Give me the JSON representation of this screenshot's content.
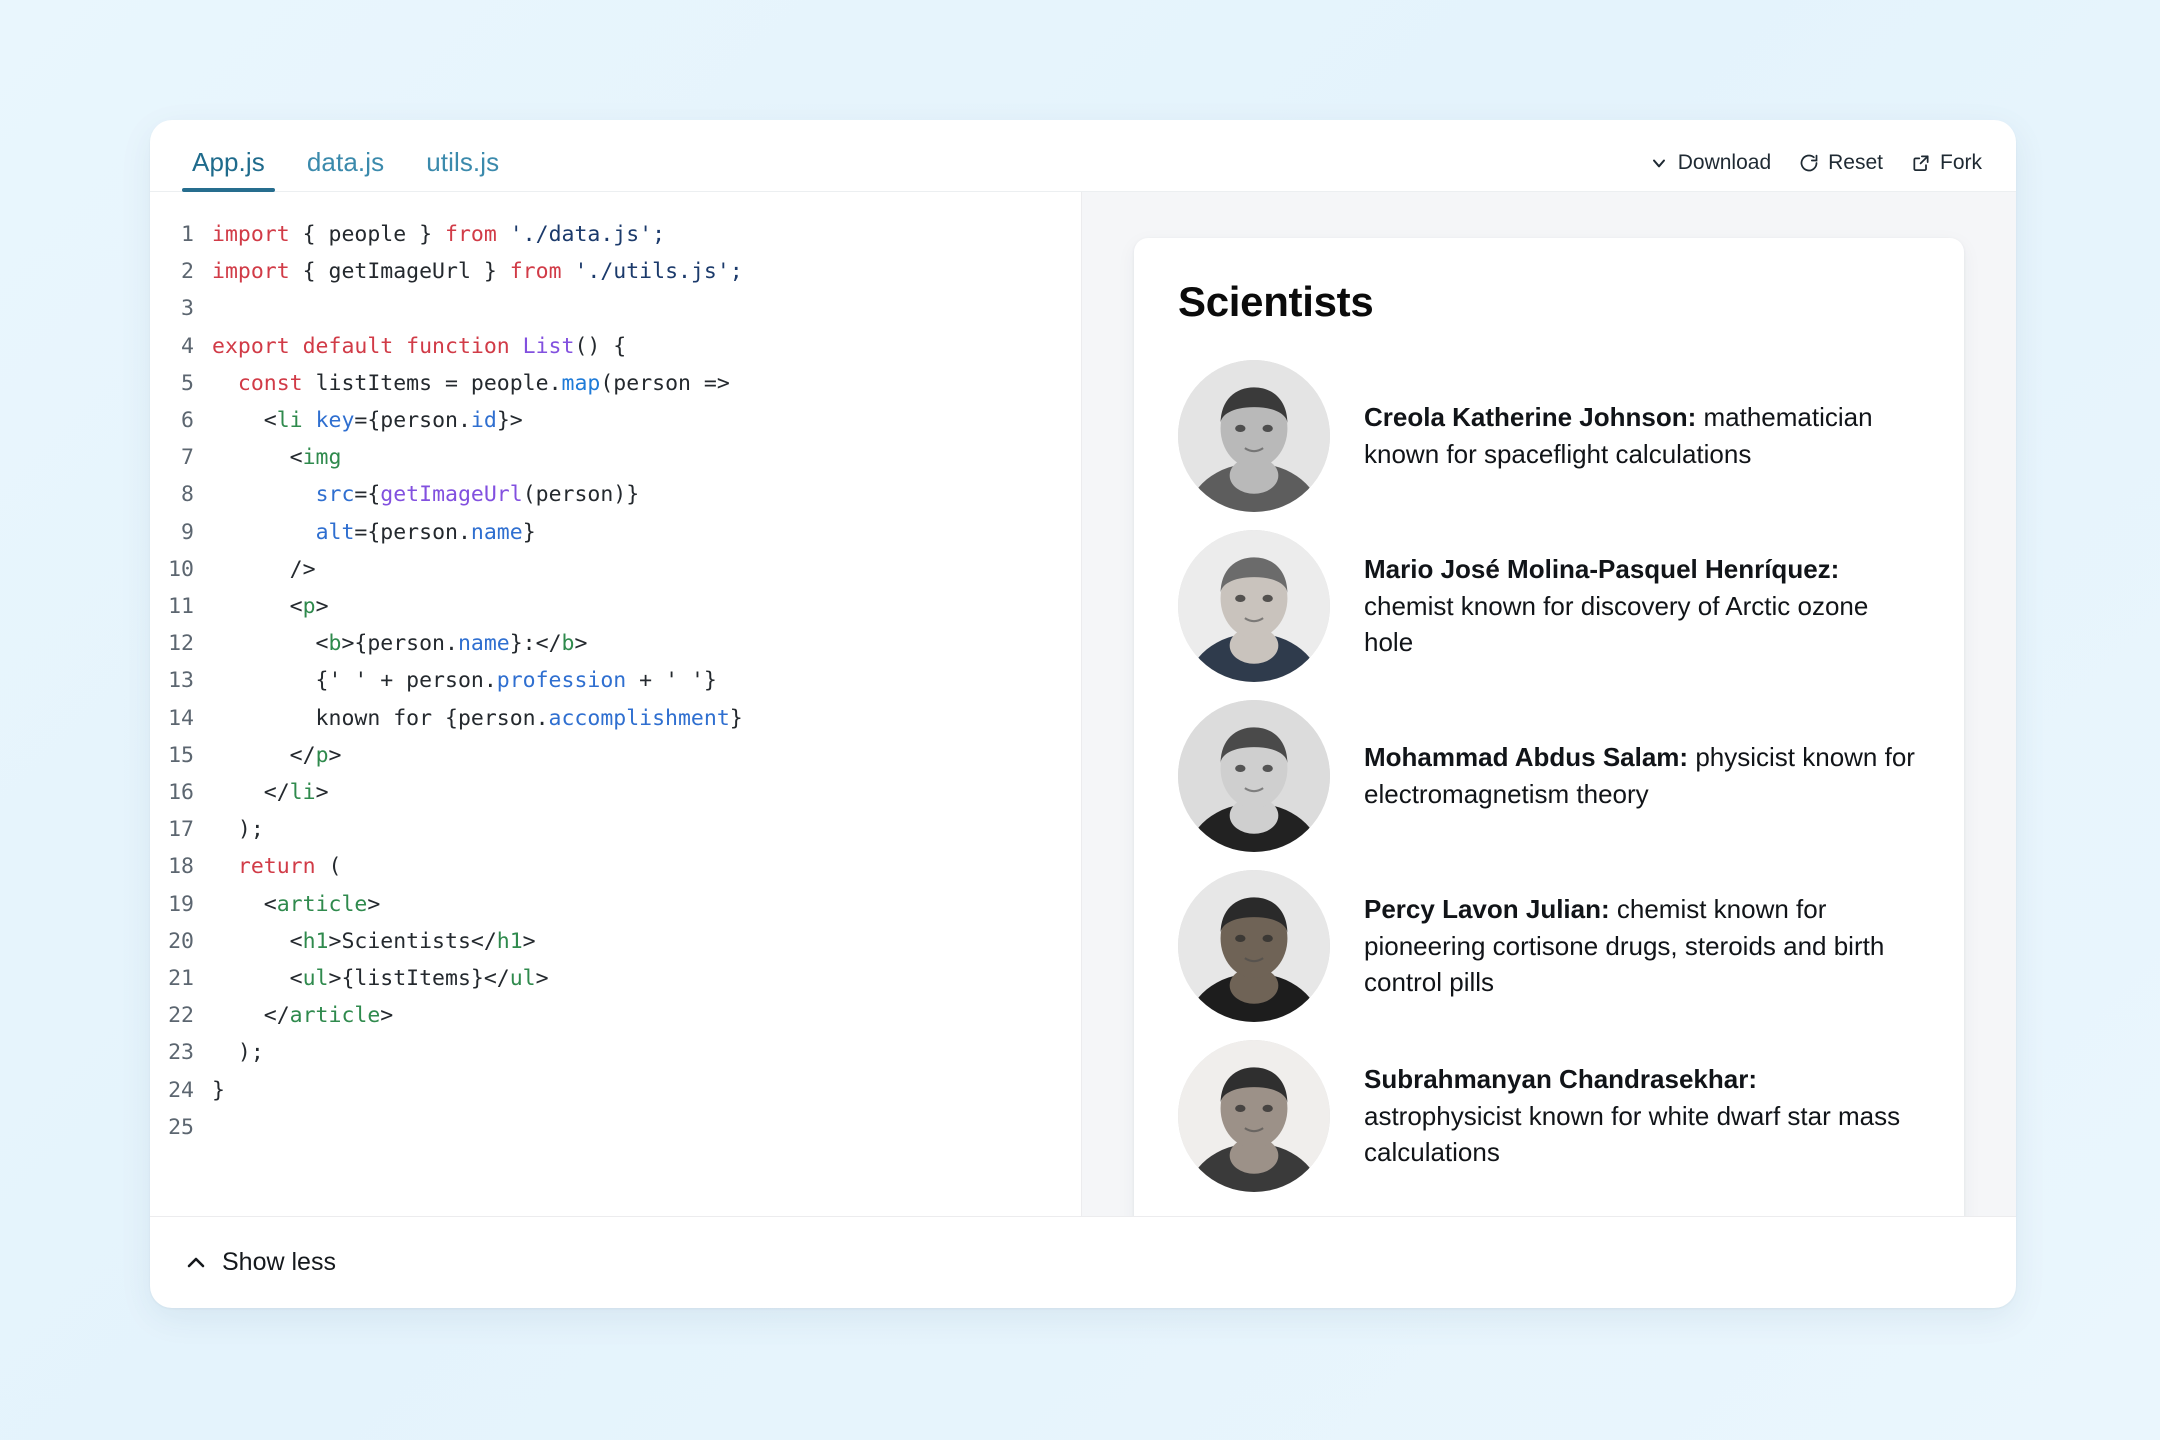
{
  "editor": {
    "tabs": [
      {
        "label": "App.js",
        "active": true
      },
      {
        "label": "data.js",
        "active": false
      },
      {
        "label": "utils.js",
        "active": false
      }
    ],
    "actions": [
      {
        "label": "Download",
        "icon": "chevron-down-icon"
      },
      {
        "label": "Reset",
        "icon": "reset-circle-icon"
      },
      {
        "label": "Fork",
        "icon": "external-link-icon"
      }
    ],
    "accent_color": "#266d8e",
    "footer": {
      "label": "Show less",
      "icon": "chevron-up-icon"
    },
    "code_lines": [
      {
        "n": "1",
        "tokens": [
          {
            "t": "import",
            "c": "k"
          },
          {
            "t": " { people } ",
            "c": "pl"
          },
          {
            "t": "from",
            "c": "k"
          },
          {
            "t": " './data.js';",
            "c": "str"
          }
        ]
      },
      {
        "n": "2",
        "tokens": [
          {
            "t": "import",
            "c": "k"
          },
          {
            "t": " { getImageUrl } ",
            "c": "pl"
          },
          {
            "t": "from",
            "c": "k"
          },
          {
            "t": " './utils.js';",
            "c": "str"
          }
        ]
      },
      {
        "n": "3",
        "tokens": []
      },
      {
        "n": "4",
        "tokens": [
          {
            "t": "export default function",
            "c": "k"
          },
          {
            "t": " ",
            "c": "pl"
          },
          {
            "t": "List",
            "c": "fn"
          },
          {
            "t": "() {",
            "c": "pl"
          }
        ]
      },
      {
        "n": "5",
        "tokens": [
          {
            "t": "  ",
            "c": "pl"
          },
          {
            "t": "const",
            "c": "k"
          },
          {
            "t": " listItems = people.",
            "c": "pl"
          },
          {
            "t": "map",
            "c": "mth"
          },
          {
            "t": "(person =>",
            "c": "pl"
          }
        ]
      },
      {
        "n": "6",
        "tokens": [
          {
            "t": "    <",
            "c": "pl"
          },
          {
            "t": "li",
            "c": "tag"
          },
          {
            "t": " ",
            "c": "pl"
          },
          {
            "t": "key",
            "c": "atr"
          },
          {
            "t": "={person.",
            "c": "pl"
          },
          {
            "t": "id",
            "c": "atr"
          },
          {
            "t": "}>",
            "c": "pl"
          }
        ]
      },
      {
        "n": "7",
        "tokens": [
          {
            "t": "      <",
            "c": "pl"
          },
          {
            "t": "img",
            "c": "tag"
          }
        ]
      },
      {
        "n": "8",
        "tokens": [
          {
            "t": "        ",
            "c": "pl"
          },
          {
            "t": "src",
            "c": "atr"
          },
          {
            "t": "={",
            "c": "pl"
          },
          {
            "t": "getImageUrl",
            "c": "fn"
          },
          {
            "t": "(person)}",
            "c": "pl"
          }
        ]
      },
      {
        "n": "9",
        "tokens": [
          {
            "t": "        ",
            "c": "pl"
          },
          {
            "t": "alt",
            "c": "atr"
          },
          {
            "t": "={person.",
            "c": "pl"
          },
          {
            "t": "name",
            "c": "atr"
          },
          {
            "t": "}",
            "c": "pl"
          }
        ]
      },
      {
        "n": "10",
        "tokens": [
          {
            "t": "      />",
            "c": "pl"
          }
        ]
      },
      {
        "n": "11",
        "tokens": [
          {
            "t": "      <",
            "c": "pl"
          },
          {
            "t": "p",
            "c": "tag"
          },
          {
            "t": ">",
            "c": "pl"
          }
        ]
      },
      {
        "n": "12",
        "tokens": [
          {
            "t": "        <",
            "c": "pl"
          },
          {
            "t": "b",
            "c": "tag"
          },
          {
            "t": ">{person.",
            "c": "pl"
          },
          {
            "t": "name",
            "c": "atr"
          },
          {
            "t": "}:</",
            "c": "pl"
          },
          {
            "t": "b",
            "c": "tag"
          },
          {
            "t": ">",
            "c": "pl"
          }
        ]
      },
      {
        "n": "13",
        "tokens": [
          {
            "t": "        {' ' + person.",
            "c": "pl"
          },
          {
            "t": "profession",
            "c": "atr"
          },
          {
            "t": " + ' '}",
            "c": "pl"
          }
        ]
      },
      {
        "n": "14",
        "tokens": [
          {
            "t": "        known for {person.",
            "c": "pl"
          },
          {
            "t": "accomplishment",
            "c": "atr"
          },
          {
            "t": "}",
            "c": "pl"
          }
        ]
      },
      {
        "n": "15",
        "tokens": [
          {
            "t": "      </",
            "c": "pl"
          },
          {
            "t": "p",
            "c": "tag"
          },
          {
            "t": ">",
            "c": "pl"
          }
        ]
      },
      {
        "n": "16",
        "tokens": [
          {
            "t": "    </",
            "c": "pl"
          },
          {
            "t": "li",
            "c": "tag"
          },
          {
            "t": ">",
            "c": "pl"
          }
        ]
      },
      {
        "n": "17",
        "tokens": [
          {
            "t": "  );",
            "c": "pl"
          }
        ]
      },
      {
        "n": "18",
        "tokens": [
          {
            "t": "  ",
            "c": "pl"
          },
          {
            "t": "return",
            "c": "k"
          },
          {
            "t": " (",
            "c": "pl"
          }
        ]
      },
      {
        "n": "19",
        "tokens": [
          {
            "t": "    <",
            "c": "pl"
          },
          {
            "t": "article",
            "c": "tag"
          },
          {
            "t": ">",
            "c": "pl"
          }
        ]
      },
      {
        "n": "20",
        "tokens": [
          {
            "t": "      <",
            "c": "pl"
          },
          {
            "t": "h1",
            "c": "tag"
          },
          {
            "t": ">Scientists</",
            "c": "pl"
          },
          {
            "t": "h1",
            "c": "tag"
          },
          {
            "t": ">",
            "c": "pl"
          }
        ]
      },
      {
        "n": "21",
        "tokens": [
          {
            "t": "      <",
            "c": "pl"
          },
          {
            "t": "ul",
            "c": "tag"
          },
          {
            "t": ">{listItems}</",
            "c": "pl"
          },
          {
            "t": "ul",
            "c": "tag"
          },
          {
            "t": ">",
            "c": "pl"
          }
        ]
      },
      {
        "n": "22",
        "tokens": [
          {
            "t": "    </",
            "c": "pl"
          },
          {
            "t": "article",
            "c": "tag"
          },
          {
            "t": ">",
            "c": "pl"
          }
        ]
      },
      {
        "n": "23",
        "tokens": [
          {
            "t": "  );",
            "c": "pl"
          }
        ]
      },
      {
        "n": "24",
        "tokens": [
          {
            "t": "}",
            "c": "pl"
          }
        ]
      },
      {
        "n": "25",
        "tokens": []
      }
    ]
  },
  "preview": {
    "title": "Scientists",
    "scientists": [
      {
        "name": "Creola Katherine Johnson:",
        "description": " mathematician known for spaceflight calculations",
        "avatar": "portrait-katherine-johnson"
      },
      {
        "name": "Mario José Molina-Pasquel Henríquez:",
        "description": " chemist known for discovery of Arctic ozone hole",
        "avatar": "portrait-mario-molina"
      },
      {
        "name": "Mohammad Abdus Salam:",
        "description": " physicist known for electromagnetism theory",
        "avatar": "portrait-abdus-salam"
      },
      {
        "name": "Percy Lavon Julian:",
        "description": " chemist known for pioneering cortisone drugs, steroids and birth control pills",
        "avatar": "portrait-percy-julian"
      },
      {
        "name": "Subrahmanyan Chandrasekhar:",
        "description": " astrophysicist known for white dwarf star mass calculations",
        "avatar": "portrait-subrahmanyan-chandrasekhar"
      }
    ]
  }
}
